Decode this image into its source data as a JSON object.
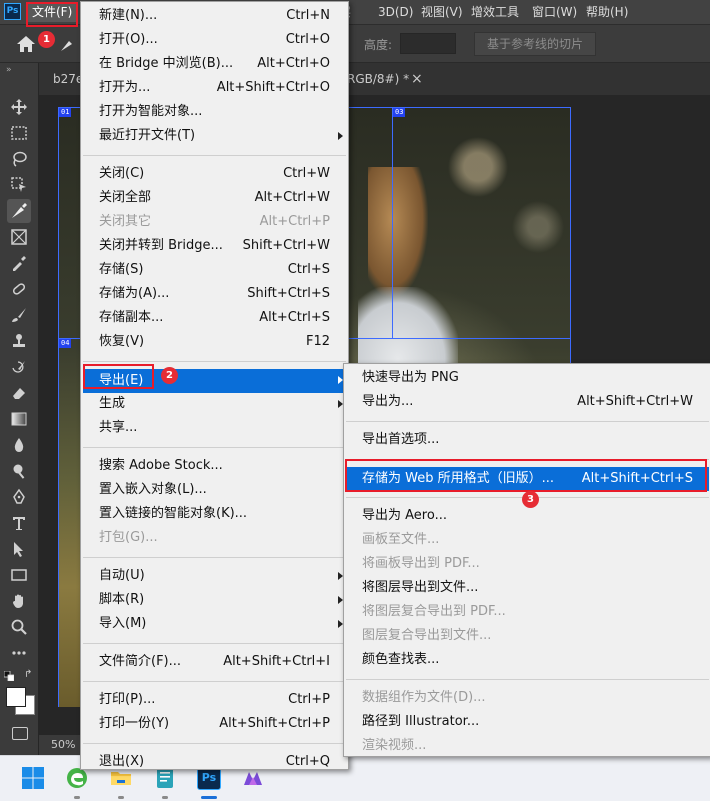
{
  "menubar": {
    "app_logo": "Ps",
    "items": [
      "文件(F)",
      "3D(D)",
      "视图(V)",
      "增效工具",
      "窗口(W)",
      "帮助(H)"
    ],
    "partial_item": "层"
  },
  "options_bar": {
    "height_label": "高度:",
    "slice_button": "基于参考线的切片"
  },
  "document": {
    "tab_left": "b27e",
    "tab_right": "RGB/8#) *",
    "close_glyph": "×",
    "zoom": "50%"
  },
  "slices": [
    "01",
    "03",
    "04"
  ],
  "file_menu": {
    "groups": [
      [
        {
          "label": "新建(N)...",
          "shortcut": "Ctrl+N"
        },
        {
          "label": "打开(O)...",
          "shortcut": "Ctrl+O"
        },
        {
          "label": "在 Bridge 中浏览(B)...",
          "shortcut": "Alt+Ctrl+O"
        },
        {
          "label": "打开为...",
          "shortcut": "Alt+Shift+Ctrl+O"
        },
        {
          "label": "打开为智能对象...",
          "shortcut": ""
        },
        {
          "label": "最近打开文件(T)",
          "shortcut": "",
          "submenu": true
        }
      ],
      [
        {
          "label": "关闭(C)",
          "shortcut": "Ctrl+W"
        },
        {
          "label": "关闭全部",
          "shortcut": "Alt+Ctrl+W"
        },
        {
          "label": "关闭其它",
          "shortcut": "Alt+Ctrl+P",
          "disabled": true
        },
        {
          "label": "关闭并转到 Bridge...",
          "shortcut": "Shift+Ctrl+W"
        },
        {
          "label": "存储(S)",
          "shortcut": "Ctrl+S"
        },
        {
          "label": "存储为(A)...",
          "shortcut": "Shift+Ctrl+S"
        },
        {
          "label": "存储副本...",
          "shortcut": "Alt+Ctrl+S"
        },
        {
          "label": "恢复(V)",
          "shortcut": "F12"
        }
      ],
      [
        {
          "label": "导出(E)",
          "shortcut": "",
          "submenu": true,
          "highlighted": true
        },
        {
          "label": "生成",
          "shortcut": "",
          "submenu": true
        },
        {
          "label": "共享...",
          "shortcut": ""
        }
      ],
      [
        {
          "label": "搜索 Adobe Stock...",
          "shortcut": ""
        },
        {
          "label": "置入嵌入对象(L)...",
          "shortcut": ""
        },
        {
          "label": "置入链接的智能对象(K)...",
          "shortcut": ""
        },
        {
          "label": "打包(G)...",
          "shortcut": "",
          "disabled": true
        }
      ],
      [
        {
          "label": "自动(U)",
          "shortcut": "",
          "submenu": true
        },
        {
          "label": "脚本(R)",
          "shortcut": "",
          "submenu": true
        },
        {
          "label": "导入(M)",
          "shortcut": "",
          "submenu": true
        }
      ],
      [
        {
          "label": "文件简介(F)...",
          "shortcut": "Alt+Shift+Ctrl+I"
        }
      ],
      [
        {
          "label": "打印(P)...",
          "shortcut": "Ctrl+P"
        },
        {
          "label": "打印一份(Y)",
          "shortcut": "Alt+Shift+Ctrl+P"
        }
      ],
      [
        {
          "label": "退出(X)",
          "shortcut": "Ctrl+Q"
        }
      ]
    ]
  },
  "export_menu": {
    "groups": [
      [
        {
          "label": "快速导出为 PNG",
          "shortcut": ""
        },
        {
          "label": "导出为...",
          "shortcut": "Alt+Shift+Ctrl+W"
        }
      ],
      [
        {
          "label": "导出首选项...",
          "shortcut": ""
        }
      ],
      [
        {
          "label": "存储为 Web 所用格式（旧版）...",
          "shortcut": "Alt+Shift+Ctrl+S",
          "highlighted": true
        }
      ],
      [
        {
          "label": "导出为 Aero...",
          "shortcut": ""
        },
        {
          "label": "画板至文件...",
          "shortcut": "",
          "disabled": true
        },
        {
          "label": "将画板导出到 PDF...",
          "shortcut": "",
          "disabled": true
        },
        {
          "label": "将图层导出到文件...",
          "shortcut": ""
        },
        {
          "label": "将图层复合导出到 PDF...",
          "shortcut": "",
          "disabled": true
        },
        {
          "label": "图层复合导出到文件...",
          "shortcut": "",
          "disabled": true
        },
        {
          "label": "颜色查找表...",
          "shortcut": ""
        }
      ],
      [
        {
          "label": "数据组作为文件(D)...",
          "shortcut": "",
          "disabled": true
        },
        {
          "label": "路径到 Illustrator...",
          "shortcut": ""
        },
        {
          "label": "渲染视频...",
          "shortcut": "",
          "disabled": true
        }
      ]
    ]
  },
  "callouts": [
    "1",
    "2",
    "3"
  ],
  "colors": {
    "highlight": "#0a6ed8",
    "callout_red": "#e81c2a",
    "slice_blue": "#3d6bff"
  }
}
